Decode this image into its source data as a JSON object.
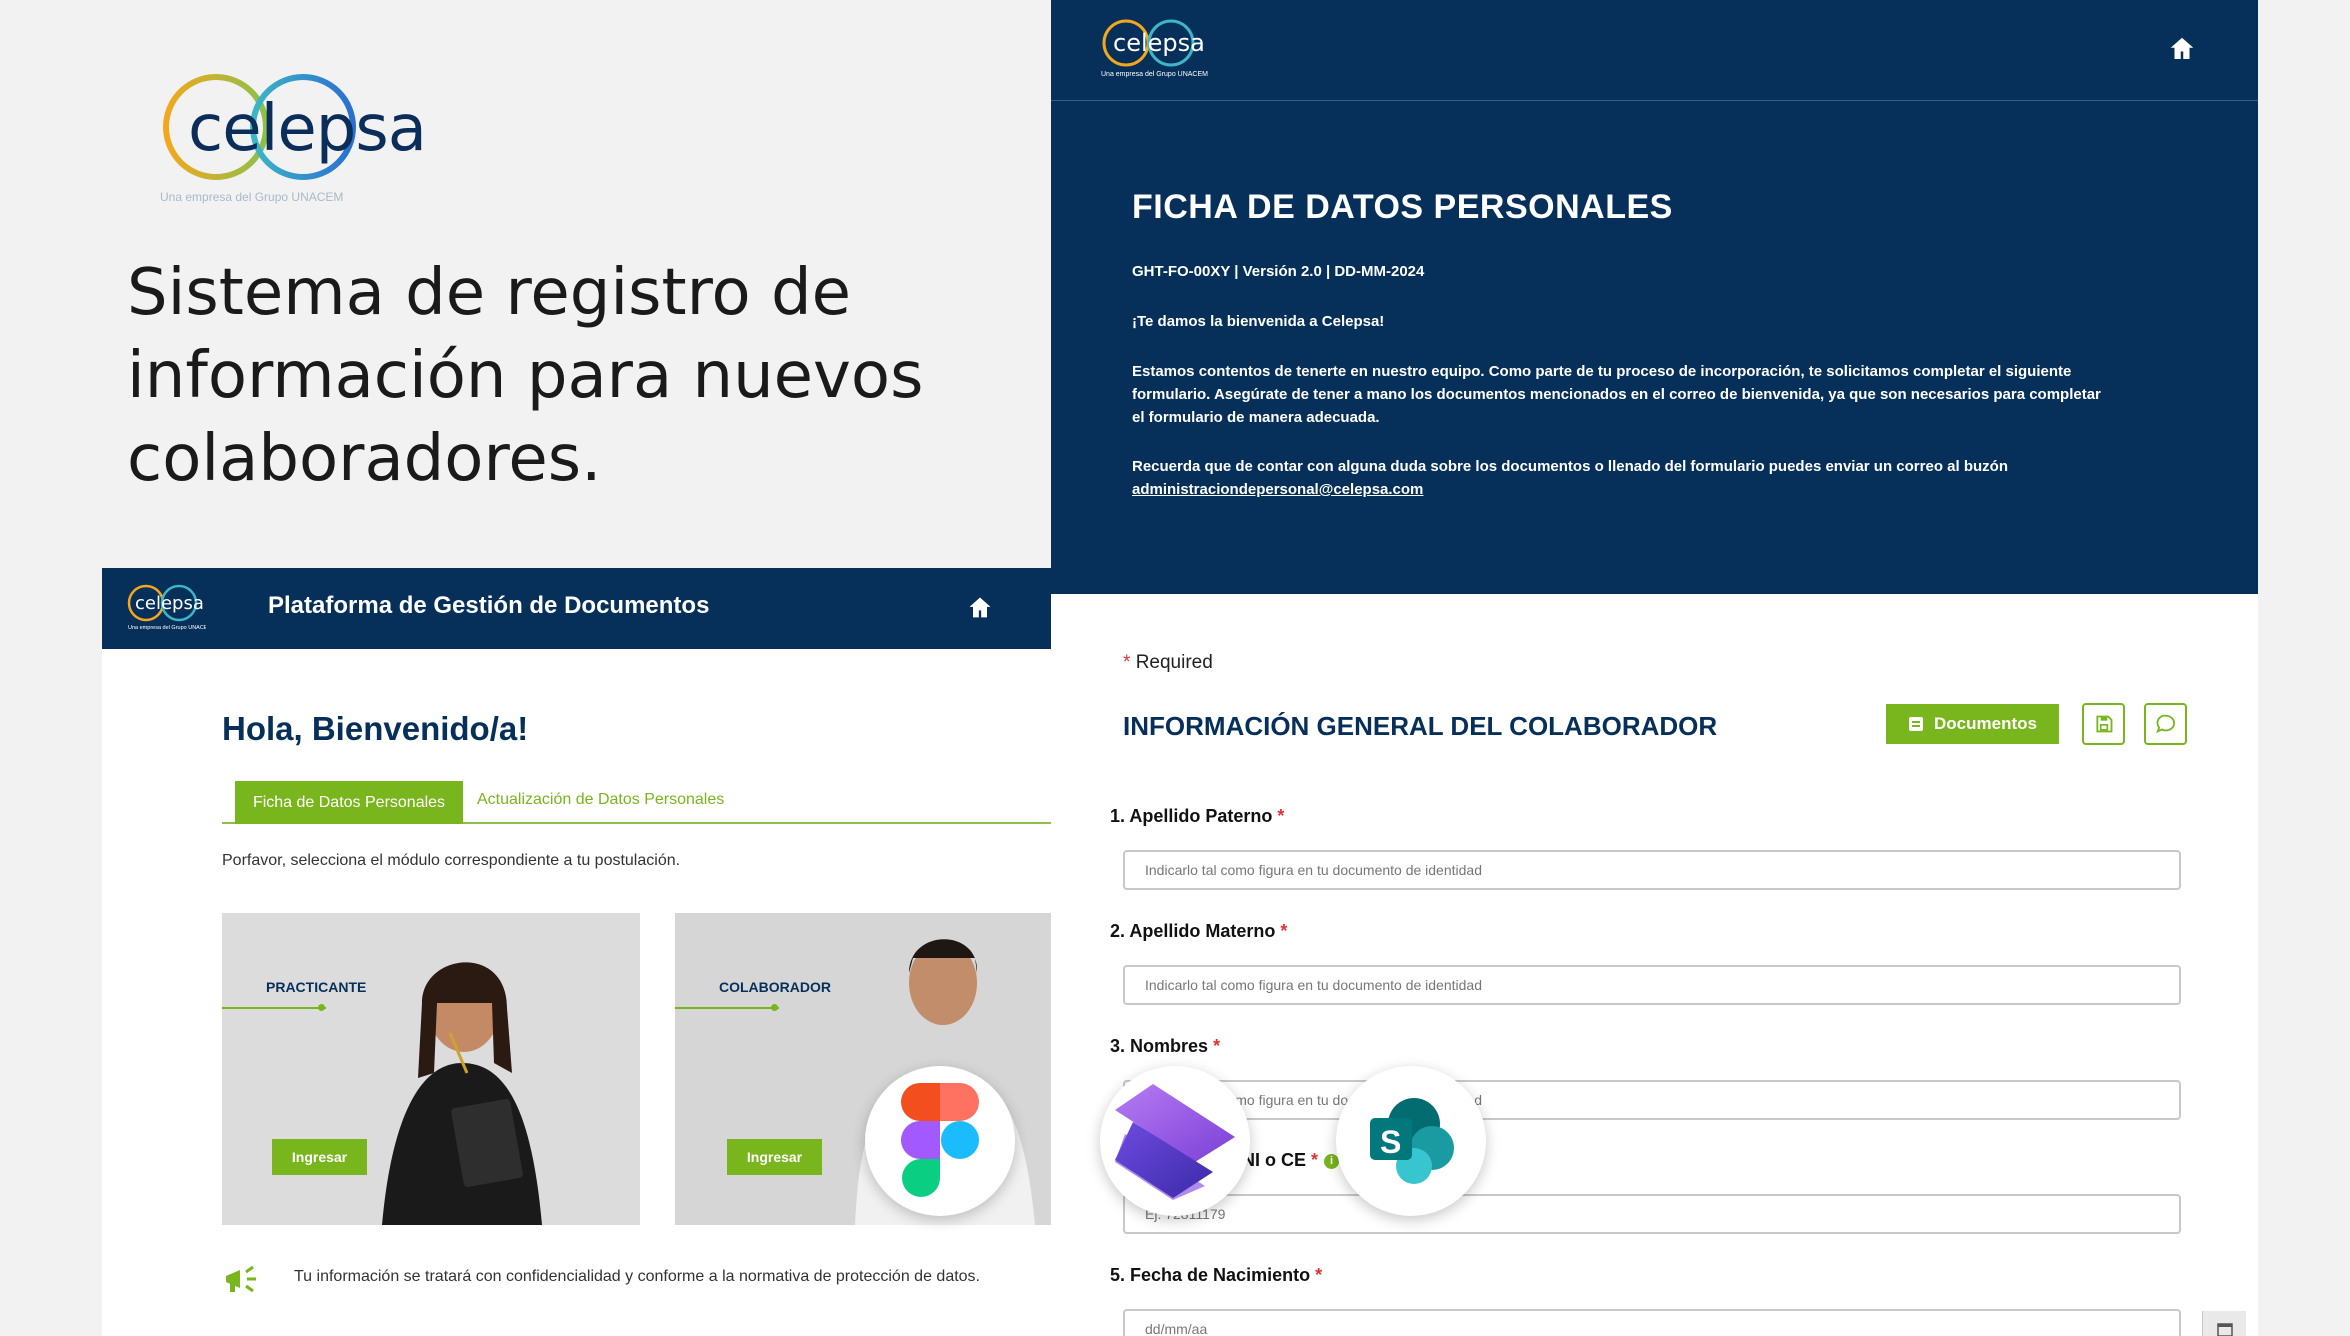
{
  "brand": {
    "logo_text": "celepsa",
    "logo_tagline": "Una empresa del Grupo UNACEM",
    "colors": {
      "navy": "#06305a",
      "green": "#79b51d",
      "required": "#e03232"
    }
  },
  "hero": {
    "title": "Sistema de registro de información para nuevos colaboradores."
  },
  "intro": {
    "title": "FICHA DE DATOS PERSONALES",
    "meta": "GHT-FO-00XY | Versión 2.0 | DD-MM-2024",
    "welcome": "¡Te damos la bienvenida a Celepsa!",
    "paragraph1": "Estamos contentos de tenerte en nuestro equipo. Como parte de tu proceso de incorporación, te solicitamos completar el siguiente formulario. Asegúrate de tener a mano los documentos mencionados en el correo de bienvenida, ya que son necesarios para completar el formulario de manera adecuada.",
    "paragraph2": "Recuerda que de contar con alguna duda sobre los documentos o llenado del formulario puedes enviar un correo al buzón",
    "email": "administraciondepersonal@celepsa.com",
    "home_icon": "home-icon"
  },
  "portal": {
    "title": "Plataforma de Gestión de Documentos",
    "greeting": "Hola, Bienvenido/a!",
    "tabs": [
      {
        "label": "Ficha de Datos Personales",
        "active": true
      },
      {
        "label": "Actualización de Datos Personales",
        "active": false
      }
    ],
    "instruction": "Porfavor, selecciona el módulo correspondiente a tu postulación.",
    "cards": [
      {
        "label": "PRACTICANTE",
        "button": "Ingresar"
      },
      {
        "label": "COLABORADOR",
        "button": "Ingresar"
      }
    ],
    "privacy": "Tu información se tratará con confidencialidad y conforme a la normativa de protección de datos.",
    "home_icon": "home-icon"
  },
  "form": {
    "required_note": "Required",
    "title": "INFORMACIÓN GENERAL DEL COLABORADOR",
    "documents_button": "Documentos",
    "save_icon": "save-icon",
    "chat_icon": "chat-icon",
    "questions": [
      {
        "label": "1. Apellido Paterno",
        "placeholder": "Indicarlo tal como figura en tu documento de identidad"
      },
      {
        "label": "2. Apellido Materno",
        "placeholder": "Indicarlo tal como figura en tu documento de identidad"
      },
      {
        "label": "3. Nombres",
        "placeholder": "Indicarlo tal como figura en tu documento de identidad"
      },
      {
        "label": "4. Número de DNI o CE",
        "placeholder": "Ej: 72811179"
      },
      {
        "label": "5. Fecha de Nacimiento",
        "placeholder": "dd/mm/aa"
      }
    ]
  },
  "badges": [
    "figma-icon",
    "power-pages-icon",
    "sharepoint-icon"
  ]
}
